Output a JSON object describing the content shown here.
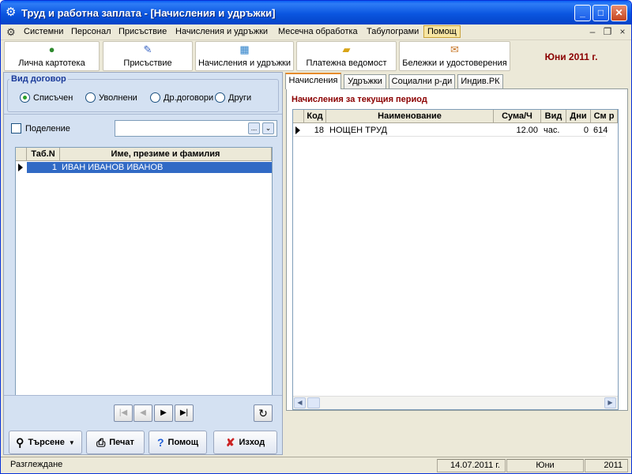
{
  "window": {
    "title": "Труд и работна заплата - [Начисления и удръжки]"
  },
  "menu": [
    "Системни",
    "Персонал",
    "Присъствие",
    "Начисления и удръжки",
    "Месечна обработка",
    "Табулограми",
    "Помощ"
  ],
  "toolbar": {
    "items": [
      "Лична картотека",
      "Присъствие",
      "Начисления и удръжки",
      "Платежна ведомост",
      "Бележки и удостоверения"
    ],
    "month": "Юни 2011 г."
  },
  "left": {
    "contract_group_label": "Вид договор",
    "radios": [
      "Списъчен",
      "Уволнени",
      "Др.договори",
      "Други"
    ],
    "selected_radio": "Списъчен",
    "division_label": "Поделение",
    "combo_btn1": "...",
    "combo_btn2": "⌄",
    "grid": {
      "headers": [
        "Таб.N",
        "Име, презиме и фамилия"
      ],
      "rows": [
        {
          "tab": "1",
          "name": "ИВАН ИВАНОВ ИВАНОВ"
        }
      ]
    },
    "buttons": {
      "search": "Търсене",
      "print": "Печат",
      "help": "Помощ",
      "exit": "Изход"
    }
  },
  "right": {
    "tabs": [
      "Начисления",
      "Удръжки",
      "Социални р-ди",
      "Индив.РК"
    ],
    "active_tab": "Начисления",
    "panel_title": "Начисления за текущия период",
    "grid": {
      "headers": [
        "Код",
        "Наименование",
        "Сума/Ч",
        "Вид",
        "Дни",
        "См р"
      ],
      "rows": [
        {
          "code": "18",
          "name": "НОЩЕН ТРУД",
          "sum": "12.00",
          "kind": "час.",
          "days": "0",
          "acc": "614"
        }
      ]
    }
  },
  "status": {
    "mode": "Разглеждане",
    "date": "14.07.2011 г.",
    "month": "Юни",
    "year": "2011"
  }
}
